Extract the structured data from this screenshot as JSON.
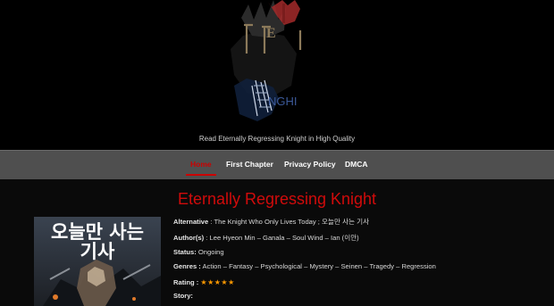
{
  "site": {
    "tagline": "Read Eternally Regressing Knight in High Quality"
  },
  "nav": [
    {
      "label": "Home"
    },
    {
      "label": "First Chapter"
    },
    {
      "label": "Privacy Policy"
    },
    {
      "label": "DMCA"
    }
  ],
  "manga": {
    "title": "Eternally Regressing Knight",
    "cover_text": "오늘만 사는 기사",
    "alternative_label": "Alternative",
    "alternative": "The Knight Who Only Lives Today ; 오늘만 사는 기사",
    "authors_label": "Author(s)",
    "authors": "Lee Hyeon Min – Ganala – Soul Wind – Ian (이안)",
    "status_label": "Status:",
    "status": "Ongoing",
    "genres_label": "Genres :",
    "genres": [
      "Action",
      "Fantasy",
      "Psychological",
      "Mystery",
      "Seinen",
      "Tragedy",
      "Regression"
    ],
    "rating_label": "Rating :",
    "rating": 5,
    "story_label": "Story:"
  },
  "colors": {
    "accent": "#d10b0b",
    "nav_bg": "#4f4f4f",
    "star": "#ff9900"
  }
}
